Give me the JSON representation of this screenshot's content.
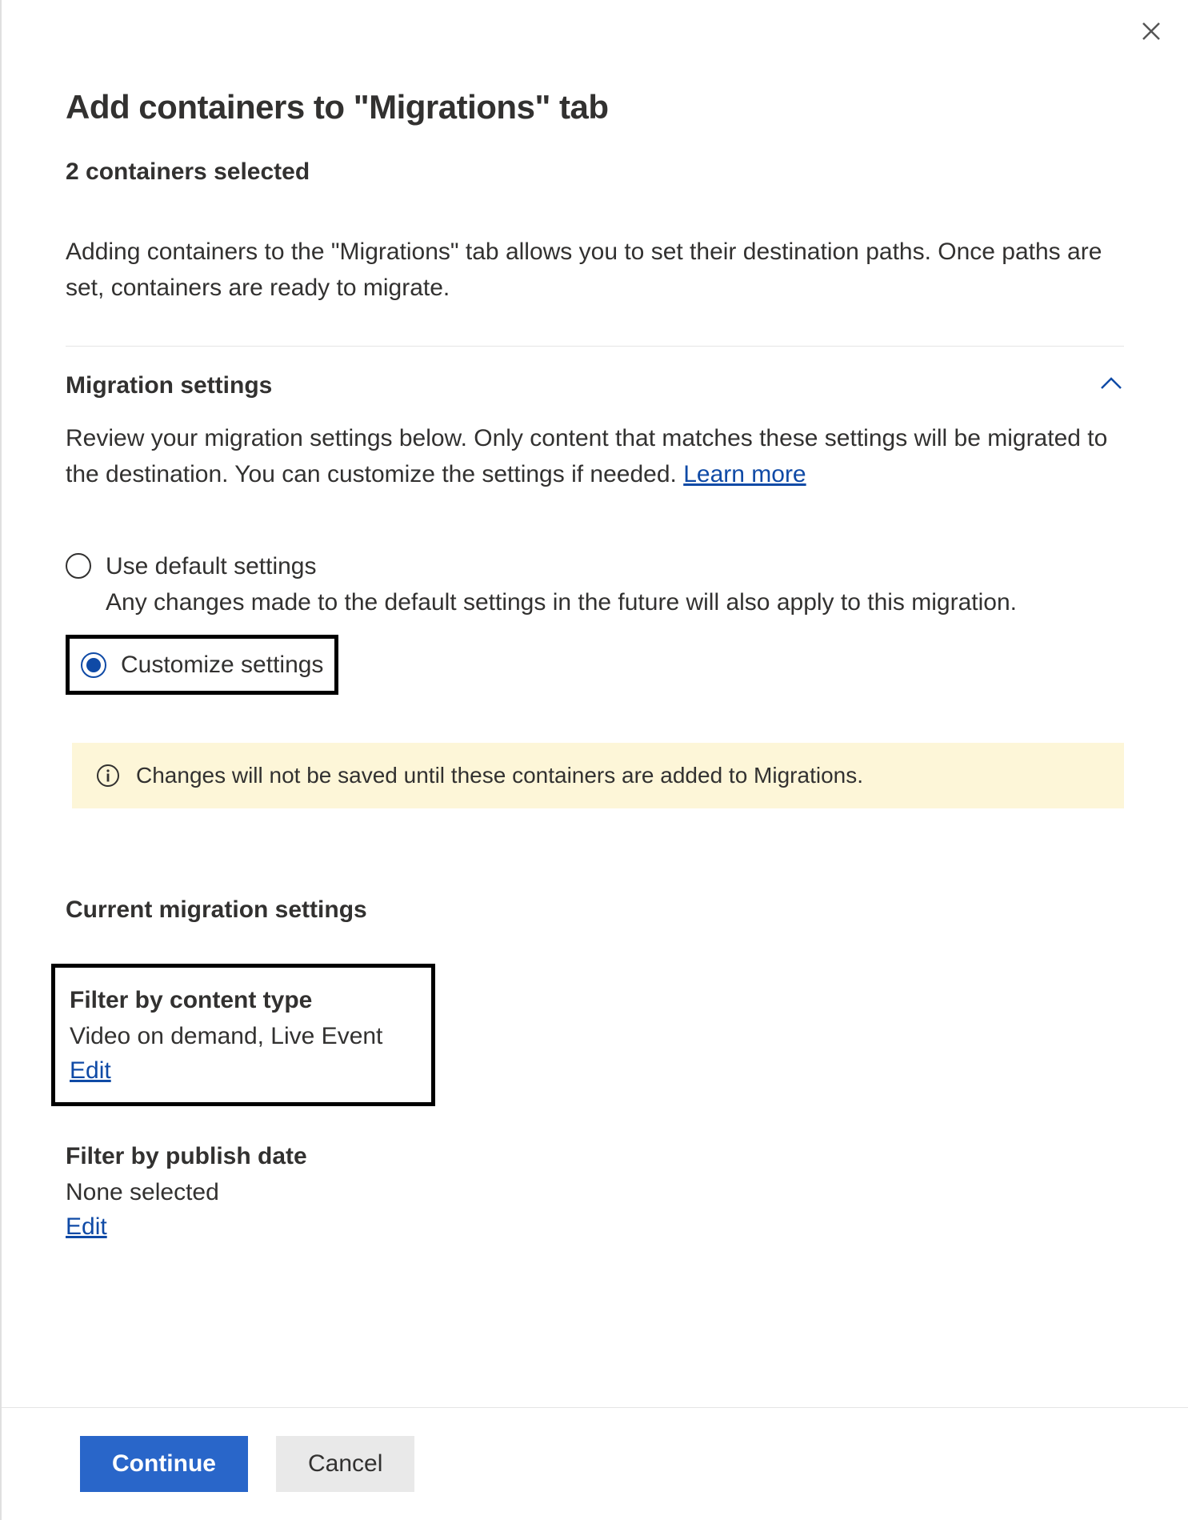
{
  "header": {
    "title": "Add containers to \"Migrations\" tab",
    "subtitle": "2 containers selected",
    "description": "Adding containers to the \"Migrations\" tab allows you to set their destination paths. Once paths are set, containers are ready to migrate."
  },
  "migration_settings": {
    "title": "Migration settings",
    "description_prefix": "Review your migration settings below. Only content that matches these settings will be migrated to the destination. You can customize the settings if needed. ",
    "learn_more": "Learn more",
    "options": {
      "default": {
        "label": "Use default settings",
        "sub": "Any changes made to the default settings in the future will also apply to this migration.",
        "selected": false
      },
      "customize": {
        "label": "Customize settings",
        "selected": true
      }
    },
    "info_banner": "Changes will not be saved until these containers are added to Migrations."
  },
  "current_settings": {
    "title": "Current migration settings",
    "items": [
      {
        "label": "Filter by content type",
        "value": "Video on demand, Live Event",
        "edit": "Edit",
        "boxed": true
      },
      {
        "label": "Filter by publish date",
        "value": "None selected",
        "edit": "Edit",
        "boxed": false
      }
    ]
  },
  "footer": {
    "continue": "Continue",
    "cancel": "Cancel"
  }
}
